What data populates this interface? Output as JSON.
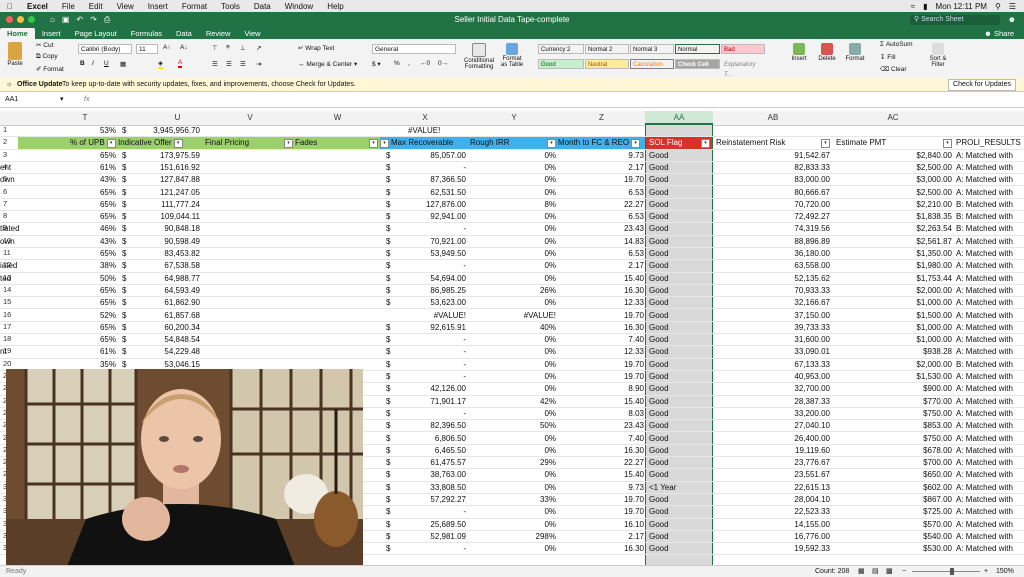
{
  "menubar": {
    "app": "Excel",
    "items": [
      "File",
      "Edit",
      "View",
      "Insert",
      "Format",
      "Tools",
      "Data",
      "Window",
      "Help"
    ],
    "clock": "Mon 12:11 PM"
  },
  "window": {
    "title": "Seller Initial Data Tape-complete",
    "search_placeholder": "Search Sheet"
  },
  "ribbon_tabs": [
    "Home",
    "Insert",
    "Page Layout",
    "Formulas",
    "Data",
    "Review",
    "View"
  ],
  "share_label": "Share",
  "ribbon": {
    "paste": "Paste",
    "cut": "Cut",
    "copy": "Copy",
    "format": "Format",
    "font_name": "Calibri (Body)",
    "font_size": "11",
    "wrap_text": "Wrap Text",
    "merge_center": "Merge & Center",
    "number_format": "General",
    "conditional_formatting": "Conditional Formatting",
    "format_as_table": "Format as Table",
    "styles": [
      {
        "label": "Currency 2",
        "bg": "#ffffff",
        "fg": "#111111"
      },
      {
        "label": "Normal 2",
        "bg": "#ffffff",
        "fg": "#111111"
      },
      {
        "label": "Normal 3",
        "bg": "#ffffff",
        "fg": "#111111"
      },
      {
        "label": "Normal",
        "bg": "#ffffff",
        "fg": "#111111"
      },
      {
        "label": "Bad",
        "bg": "#ffc7ce",
        "fg": "#9c0006"
      },
      {
        "label": "Good",
        "bg": "#c6efce",
        "fg": "#006100"
      },
      {
        "label": "Neutral",
        "bg": "#ffeb9c",
        "fg": "#9c5700"
      },
      {
        "label": "Calculation",
        "bg": "#f2f2f2",
        "fg": "#fa7d00"
      },
      {
        "label": "Check Cell",
        "bg": "#a5a5a5",
        "fg": "#ffffff"
      },
      {
        "label": "Explanatory T...",
        "bg": "#ffffff",
        "fg": "#7f7f7f"
      }
    ],
    "insert": "Insert",
    "delete": "Delete",
    "format_btn": "Format",
    "autosum": "AutoSum",
    "fill": "Fill",
    "clear": "Clear",
    "sort_filter": "Sort & Filter"
  },
  "update_bar": {
    "title": "Office Update",
    "message": "To keep up-to-date with security updates, fixes, and improvements, choose Check for Updates.",
    "button": "Check for Updates"
  },
  "formula_bar": {
    "name_box": "AA1",
    "fx": "fx",
    "value": ""
  },
  "columns": [
    "T",
    "U",
    "V",
    "W",
    "X",
    "Y",
    "Z",
    "AA",
    "AB",
    "AC"
  ],
  "row1": {
    "T": "53%",
    "U_sym": "$",
    "U": "3,945,956.70",
    "X": "#VALUE!"
  },
  "headers": {
    "T": "% of UPB",
    "U": "Indicative Offer",
    "V": "Final Pricing",
    "W": "Fades",
    "X": "Max Recoverable",
    "Y": "Rough IRR",
    "Z": "Month to FC & REO",
    "AA": "SOL Flag",
    "AB": "Reinstatement Risk",
    "AC": "Estimate PMT",
    "AD": "PROLI_RESULTS"
  },
  "rows": [
    {
      "n": "3",
      "s": "",
      "t": "65%",
      "u": "173,975.59",
      "x": "85,057.00",
      "y": "0%",
      "z": "9.73",
      "aa": "Good",
      "ab": "91,542.67",
      "ac": "$2,840.00",
      "ad": "A:  Matched with"
    },
    {
      "n": "4",
      "s": "ent",
      "t": "61%",
      "u": "151,616.92",
      "x": "-",
      "y": "0%",
      "z": "2.17",
      "aa": "Good",
      "ab": "82,833.33",
      "ac": "$2,500.00",
      "ad": "A:  Matched with"
    },
    {
      "n": "5",
      "s": "own",
      "t": "43%",
      "u": "127,847.88",
      "x": "87,366.50",
      "y": "0%",
      "z": "19.70",
      "aa": "Good",
      "ab": "83,000.00",
      "ac": "$3,000.00",
      "ad": "A:  Matched with"
    },
    {
      "n": "6",
      "s": "",
      "t": "65%",
      "u": "121,247.05",
      "x": "62,531.50",
      "y": "0%",
      "z": "6.53",
      "aa": "Good",
      "ab": "80,666.67",
      "ac": "$2,500.00",
      "ad": "A:  Matched with"
    },
    {
      "n": "7",
      "s": "",
      "t": "65%",
      "u": "111,777.24",
      "x": "127,876.00",
      "y": "8%",
      "z": "22.27",
      "aa": "Good",
      "ab": "70,720.00",
      "ac": "$2,210.00",
      "ad": "B:  Matched with"
    },
    {
      "n": "8",
      "s": "",
      "t": "65%",
      "u": "109,044.11",
      "x": "92,941.00",
      "y": "0%",
      "z": "6.53",
      "aa": "Good",
      "ab": "72,492.27",
      "ac": "$1,838.35",
      "ad": "B:  Matched with"
    },
    {
      "n": "9",
      "s": "tiated",
      "t": "46%",
      "u": "90,848.18",
      "x": "-",
      "y": "0%",
      "z": "23.43",
      "aa": "Good",
      "ab": "74,319.56",
      "ac": "$2,263.54",
      "ad": "B:  Matched with"
    },
    {
      "n": "10",
      "s": "own",
      "t": "43%",
      "u": "90,598.49",
      "x": "70,921.00",
      "y": "0%",
      "z": "14.83",
      "aa": "Good",
      "ab": "88,896.89",
      "ac": "$2,561.87",
      "ad": "A:  Matched with"
    },
    {
      "n": "11",
      "s": "",
      "t": "65%",
      "u": "83,453.82",
      "x": "53,949.50",
      "y": "0%",
      "z": "6.53",
      "aa": "Good",
      "ab": "36,180.00",
      "ac": "$1,350.00",
      "ad": "A:  Matched with"
    },
    {
      "n": "12",
      "s": "iated",
      "t": "38%",
      "u": "67,538.58",
      "x": "-",
      "y": "0%",
      "z": "2.17",
      "aa": "Good",
      "ab": "63,558.00",
      "ac": "$1,980.00",
      "ad": "A:  Matched with"
    },
    {
      "n": "13",
      "s": "ted",
      "t": "50%",
      "u": "64,988.77",
      "x": "54,694.00",
      "y": "0%",
      "z": "15.40",
      "aa": "Good",
      "ab": "52,135.62",
      "ac": "$1,753.44",
      "ad": "A:  Matched with"
    },
    {
      "n": "14",
      "s": "",
      "t": "65%",
      "u": "64,593.49",
      "x": "86,985.25",
      "y": "26%",
      "z": "16.30",
      "aa": "Good",
      "ab": "70,933.33",
      "ac": "$2,000.00",
      "ad": "A:  Matched with"
    },
    {
      "n": "15",
      "s": "",
      "t": "65%",
      "u": "61,862.90",
      "x": "53,623.00",
      "y": "0%",
      "z": "12.33",
      "aa": "Good",
      "ab": "32,166.67",
      "ac": "$1,000.00",
      "ad": "A:  Matched with"
    },
    {
      "n": "16",
      "s": "",
      "t": "52%",
      "u": "61,857.68",
      "x": "#VALUE!",
      "y": "#VALUE!",
      "z": "19.70",
      "aa": "Good",
      "ab": "37,150.00",
      "ac": "$1,500.00",
      "ad": "A:  Matched with"
    },
    {
      "n": "17",
      "s": "",
      "t": "65%",
      "u": "60,200.34",
      "x": "92,615.91",
      "y": "40%",
      "z": "16.30",
      "aa": "Good",
      "ab": "39,733.33",
      "ac": "$1,000.00",
      "ad": "A:  Matched with"
    },
    {
      "n": "18",
      "s": "",
      "t": "65%",
      "u": "54,848.54",
      "x": "-",
      "y": "0%",
      "z": "7.40",
      "aa": "Good",
      "ab": "31,600.00",
      "ac": "$1,000.00",
      "ad": "A:  Matched with"
    },
    {
      "n": "19",
      "s": "nt",
      "t": "61%",
      "u": "54,229.48",
      "x": "-",
      "y": "0%",
      "z": "12.33",
      "aa": "Good",
      "ab": "33,090.01",
      "ac": "$938.28",
      "ad": "A:  Matched with"
    },
    {
      "n": "20",
      "s": "",
      "t": "35%",
      "u": "53,046.15",
      "x": "-",
      "y": "0%",
      "z": "19.70",
      "aa": "Good",
      "ab": "67,133.33",
      "ac": "$2,000.00",
      "ad": "B:  Matched with"
    },
    {
      "n": "21",
      "s": "",
      "t": "",
      "u": "",
      "x": "-",
      "y": "0%",
      "z": "19.70",
      "aa": "Good",
      "ab": "40,953.00",
      "ac": "$1,530.00",
      "ad": "A:  Matched with"
    },
    {
      "n": "22",
      "s": "",
      "t": "",
      "u": "",
      "x": "42,126.00",
      "y": "0%",
      "z": "8.90",
      "aa": "Good",
      "ab": "32,700.00",
      "ac": "$900.00",
      "ad": "A:  Matched with"
    },
    {
      "n": "23",
      "s": "",
      "t": "",
      "u": "",
      "x": "71,901.17",
      "y": "42%",
      "z": "15.40",
      "aa": "Good",
      "ab": "28,387.33",
      "ac": "$770.00",
      "ad": "A:  Matched with"
    },
    {
      "n": "24",
      "s": "",
      "t": "",
      "u": "",
      "x": "-",
      "y": "0%",
      "z": "8.03",
      "aa": "Good",
      "ab": "33,200.00",
      "ac": "$750.00",
      "ad": "A:  Matched with"
    },
    {
      "n": "25",
      "s": "",
      "t": "",
      "u": "",
      "x": "82,396.50",
      "y": "50%",
      "z": "23.43",
      "aa": "Good",
      "ab": "27,040.10",
      "ac": "$853.00",
      "ad": "A:  Matched with"
    },
    {
      "n": "26",
      "s": "",
      "t": "",
      "u": "",
      "x": "6,806.50",
      "y": "0%",
      "z": "7.40",
      "aa": "Good",
      "ab": "26,400.00",
      "ac": "$750.00",
      "ad": "A:  Matched with"
    },
    {
      "n": "27",
      "s": "",
      "t": "",
      "u": "",
      "x": "6,465.50",
      "y": "0%",
      "z": "16.30",
      "aa": "Good",
      "ab": "19,119.60",
      "ac": "$678.00",
      "ad": "A:  Matched with"
    },
    {
      "n": "28",
      "s": "",
      "t": "",
      "u": "",
      "x": "61,475.57",
      "y": "29%",
      "z": "22.27",
      "aa": "Good",
      "ab": "23,776.67",
      "ac": "$700.00",
      "ad": "A:  Matched with"
    },
    {
      "n": "29",
      "s": "",
      "t": "",
      "u": "",
      "x": "38,763.00",
      "y": "0%",
      "z": "15.40",
      "aa": "Good",
      "ab": "23,551.67",
      "ac": "$650.00",
      "ad": "A:  Matched with"
    },
    {
      "n": "30",
      "s": "",
      "t": "",
      "u": ".50",
      "x": "33,808.50",
      "y": "0%",
      "z": "9.73",
      "aa": "<1 Year",
      "ab": "22,615.13",
      "ac": "$602.00",
      "ad": "A:  Matched with"
    },
    {
      "n": "31",
      "s": "",
      "t": "",
      "u": "",
      "x": "57,292.27",
      "y": "33%",
      "z": "19.70",
      "aa": "Good",
      "ab": "28,004.10",
      "ac": "$867.00",
      "ad": "A:  Matched with"
    },
    {
      "n": "32",
      "s": "",
      "t": "",
      "u": "",
      "x": "-",
      "y": "0%",
      "z": "19.70",
      "aa": "Good",
      "ab": "22,523.33",
      "ac": "$725.00",
      "ad": "A:  Matched with"
    },
    {
      "n": "33",
      "s": "",
      "t": "",
      "u": "",
      "x": "25,689.50",
      "y": "0%",
      "z": "16.10",
      "aa": "Good",
      "ab": "14,155.00",
      "ac": "$570.00",
      "ad": "A:  Matched with"
    },
    {
      "n": "34",
      "s": "",
      "t": "",
      "u": "",
      "x": "52,981.09",
      "y": "298%",
      "z": "2.17",
      "aa": "Good",
      "ab": "16,776.00",
      "ac": "$540.00",
      "ad": "A:  Matched with"
    },
    {
      "n": "35",
      "s": "",
      "t": "",
      "u": "",
      "x": "-",
      "y": "0%",
      "z": "16.30",
      "aa": "Good",
      "ab": "19,592.33",
      "ac": "$530.00",
      "ad": "A:  Matched with"
    }
  ],
  "status_bar": {
    "ready": "Ready",
    "count": "Count: 208",
    "zoom": "150%"
  },
  "colors": {
    "excel_green": "#217346",
    "header_green": "#9bd06c",
    "header_blue": "#3fb0ea",
    "header_red": "#d9302a"
  }
}
